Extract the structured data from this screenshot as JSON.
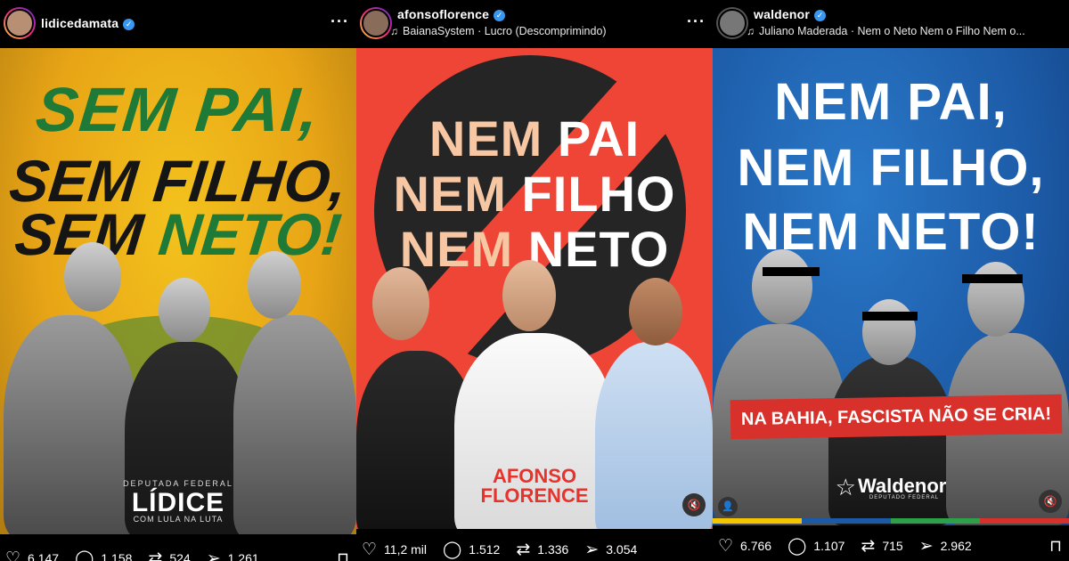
{
  "posts": [
    {
      "username": "lidicedamata",
      "verified": true,
      "headline": [
        "SEM PAI,",
        "SEM FILHO,",
        "SEM",
        "NETO!"
      ],
      "signature_top": "DEPUTADA FEDERAL",
      "signature_name": "LÍDICE",
      "signature_sub": "COM LULA NA LUTA",
      "stats": {
        "likes": "6.147",
        "comments": "1.158",
        "reposts": "524",
        "shares": "1.261"
      }
    },
    {
      "username": "afonsoflorence",
      "verified": true,
      "music": "BaianaSystem · Lucro (Descomprimindo)",
      "headline": [
        [
          "NEM",
          "PAI"
        ],
        [
          "NEM",
          "FILHO"
        ],
        [
          "NEM",
          "NETO"
        ]
      ],
      "logo": [
        "AFONSO",
        "FLORENCE"
      ],
      "stats": {
        "likes": "11,2 mil",
        "comments": "1.512",
        "reposts": "1.336",
        "shares": "3.054"
      }
    },
    {
      "username": "waldenor",
      "verified": true,
      "music": "Juliano Maderada · Nem o Neto Nem o Filho Nem o...",
      "headline": [
        "NEM PAI,",
        "NEM FILHO,",
        "NEM NETO!"
      ],
      "banner": "NA BAHIA, FASCISTA NÃO SE CRIA!",
      "logo": "Waldenor",
      "logo_sub": "DEPUTADO FEDERAL",
      "stats": {
        "likes": "6.766",
        "comments": "1.107",
        "reposts": "715",
        "shares": "2.962"
      }
    }
  ],
  "colors": {
    "green": "#1e7a36",
    "red": "#ef4536",
    "blue": "#1c5aa6",
    "verified": "#3897f0"
  },
  "icons": {
    "like": "heart-icon",
    "comment": "comment-icon",
    "repost": "repost-icon",
    "share": "share-icon",
    "save": "bookmark-icon",
    "more": "more-icon",
    "music": "music-note-icon",
    "mute": "speaker-muted-icon"
  }
}
